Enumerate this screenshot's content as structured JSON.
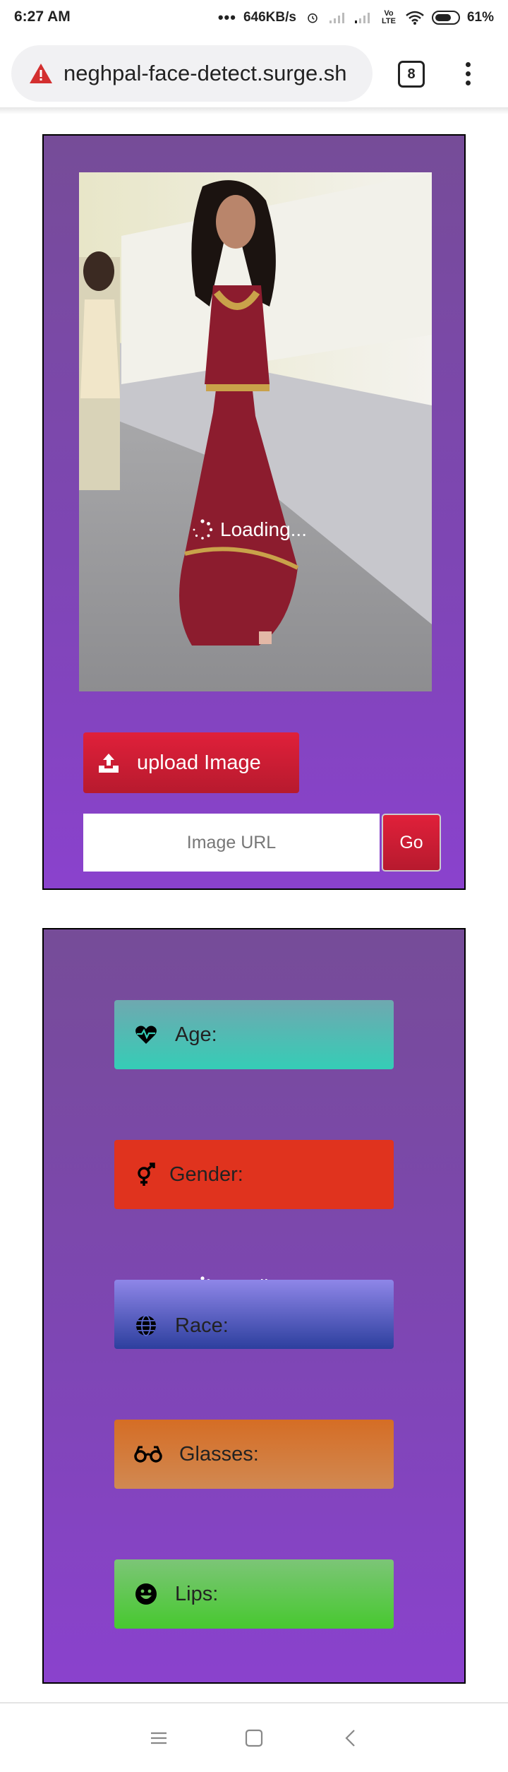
{
  "status_bar": {
    "time": "6:27 AM",
    "dots": "•••",
    "speed": "646KB/s",
    "network_label": "Vo LTE",
    "battery": "61%"
  },
  "browser": {
    "url": "neghpal-face-detect.surge.sh",
    "tab_count": "8",
    "security_icon": "warning-triangle-icon"
  },
  "uploader": {
    "loading_text": "Loading...",
    "upload_label": "upload Image",
    "url_placeholder": "Image URL",
    "go_label": "Go"
  },
  "results": {
    "loading_text": "Loading...",
    "items": [
      {
        "label": "Age:",
        "icon": "heartbeat-icon",
        "color": "#35cdb6"
      },
      {
        "label": "Gender:",
        "icon": "gender-icon",
        "color": "#e0331e"
      },
      {
        "label": "Race:",
        "icon": "globe-icon",
        "color": "#2d3f9e"
      },
      {
        "label": "Glasses:",
        "icon": "glasses-icon",
        "color": "#d56d25"
      },
      {
        "label": "Lips:",
        "icon": "smile-icon",
        "color": "#47c92f"
      }
    ]
  },
  "colors": {
    "panel": "#7e46b4",
    "button_red": "#c91c33"
  }
}
